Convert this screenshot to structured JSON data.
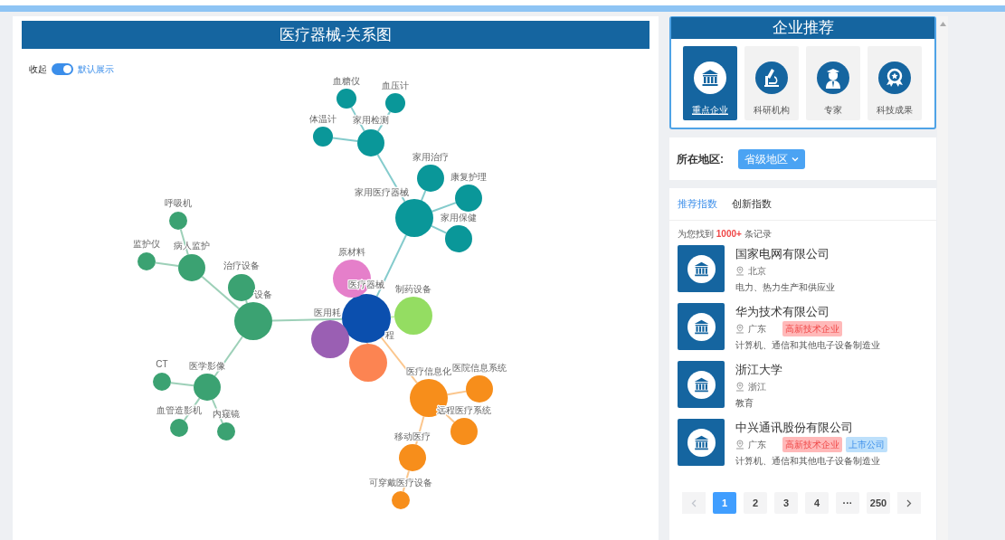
{
  "graph": {
    "title": "医疗器械-关系图",
    "toggle": {
      "label": "收起",
      "on": true,
      "caption": "默认展示"
    },
    "root": {
      "label": "医疗器械",
      "color": "#0b4fae",
      "children": [
        {
          "label": "家用医疗器械",
          "color": "#0a9799",
          "children": [
            {
              "label": "家用检测",
              "children": [
                {
                  "label": "血糖仪"
                },
                {
                  "label": "血压计"
                },
                {
                  "label": "体温计"
                }
              ]
            },
            {
              "label": "家用治疗"
            },
            {
              "label": "康复护理"
            },
            {
              "label": "家用保健"
            }
          ]
        },
        {
          "label": "原材料",
          "color": "#e57fca"
        },
        {
          "label": "制药设备",
          "color": "#94dd62"
        },
        {
          "label": "医疗信息化",
          "color": "#f78e1b",
          "children": [
            {
              "label": "医院信息系统"
            },
            {
              "label": "远程医疗系统"
            },
            {
              "label": "移动医疗",
              "children": [
                {
                  "label": "可穿戴医疗设备"
                }
              ]
            }
          ]
        },
        {
          "label": "程",
          "color": "#fc8452"
        },
        {
          "label": "医用耗",
          "color": "#9a5fb3"
        },
        {
          "label": "设备",
          "color": "#3ba272",
          "children": [
            {
              "label": "病人监护",
              "children": [
                {
                  "label": "呼吸机"
                },
                {
                  "label": "监护仪"
                }
              ]
            },
            {
              "label": "治疗设备"
            },
            {
              "label": "医学影像",
              "children": [
                {
                  "label": "CT"
                },
                {
                  "label": "血管造影机"
                },
                {
                  "label": "内窥镜"
                }
              ]
            }
          ]
        }
      ]
    }
  },
  "recommend": {
    "title": "企业推荐",
    "categories": [
      {
        "label": "重点企业",
        "kind": "building",
        "selected": true
      },
      {
        "label": "科研机构",
        "kind": "microscope",
        "selected": false
      },
      {
        "label": "专家",
        "kind": "person",
        "selected": false
      },
      {
        "label": "科技成果",
        "kind": "medal",
        "selected": false
      }
    ]
  },
  "region": {
    "label": "所在地区:",
    "value": "省级地区"
  },
  "tabs": [
    {
      "label": "推荐指数",
      "selected": true
    },
    {
      "label": "创新指数",
      "selected": false
    }
  ],
  "result_summary": "为您找到 **1000+** 条记录",
  "companies": [
    {
      "name": "国家电网有限公司",
      "location": "北京",
      "industry": "电力、热力生产和供应业"
    },
    {
      "name": "华为技术有限公司",
      "location": "广东",
      "tags": [
        {
          "label": "高新技术企业",
          "kind": "high-tech"
        }
      ],
      "industry": "计算机、通信和其他电子设备制造业"
    },
    {
      "name": "浙江大学",
      "location": "浙江",
      "industry": "教育"
    },
    {
      "name": "中兴通讯股份有限公司",
      "location": "广东",
      "tags": [
        {
          "label": "高新技术企业",
          "kind": "high-tech"
        },
        {
          "label": "上市公司",
          "kind": "listed"
        }
      ],
      "industry": "计算机、通信和其他电子设备制造业"
    }
  ],
  "pagination": {
    "pages": [
      {
        "label": "1",
        "selected": true
      },
      {
        "label": "2",
        "selected": false
      },
      {
        "label": "3",
        "selected": false
      },
      {
        "label": "4",
        "selected": false
      },
      {
        "label": "···",
        "selected": false
      },
      {
        "label": "250",
        "selected": false
      }
    ]
  }
}
